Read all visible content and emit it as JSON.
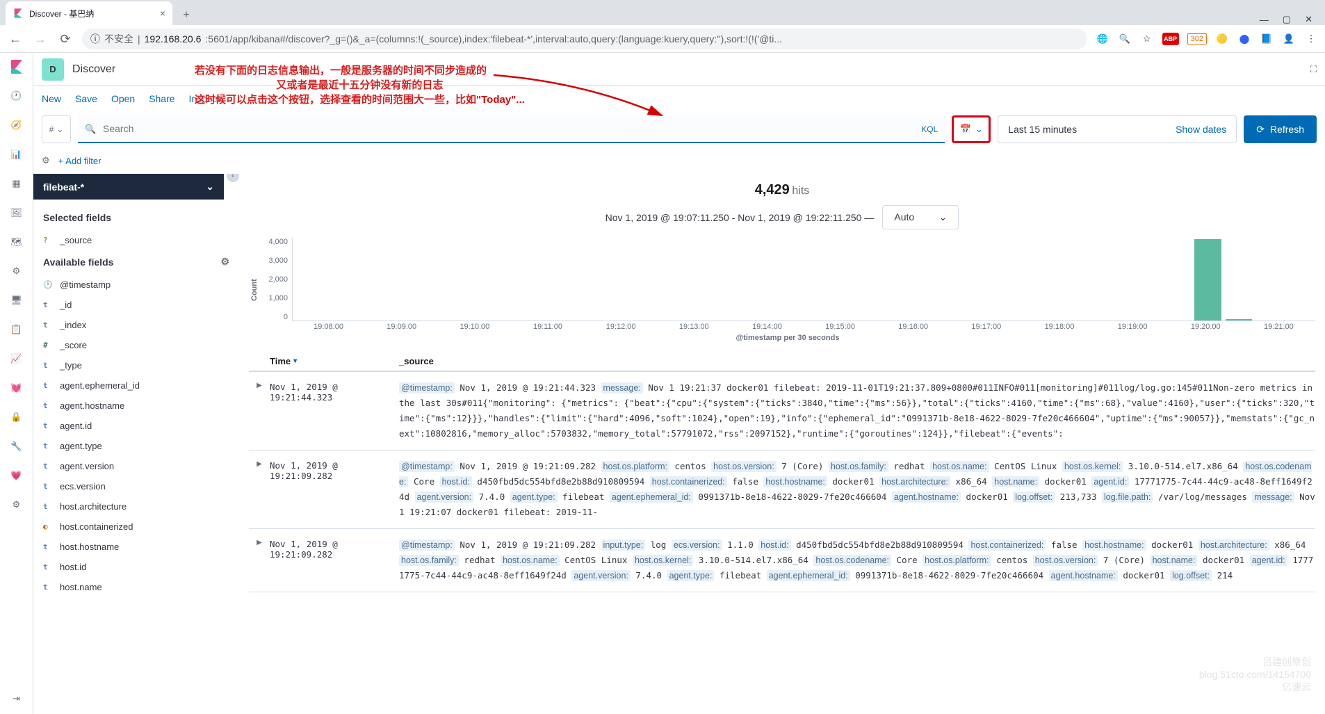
{
  "browser": {
    "tab_title": "Discover - 基巴纳",
    "url_insecure": "不安全",
    "url_domain": "192.168.20.6",
    "url_port_path": ":5601/app/kibana#/discover?_g=()&_a=(columns:!(_source),index:'filebeat-*',interval:auto,query:(language:kuery,query:''),sort:!(!('@ti...",
    "badge": "302"
  },
  "header": {
    "space": "D",
    "breadcrumb": "Discover"
  },
  "top_menu": [
    "New",
    "Save",
    "Open",
    "Share",
    "Inspect"
  ],
  "annotation": {
    "line1": "若没有下面的日志信息输出，一般是服务器的时间不同步造成的",
    "line2": "又或者是最近十五分钟没有新的日志",
    "line3": "这时候可以点击这个按钮，选择查看的时间范围大一些，比如\"Today\"..."
  },
  "query": {
    "filter_btn": "#",
    "search_placeholder": "Search",
    "kql": "KQL",
    "time_range": "Last 15 minutes",
    "show_dates": "Show dates",
    "refresh": "Refresh",
    "add_filter": "+ Add filter"
  },
  "sidebar": {
    "index_pattern": "filebeat-*",
    "selected_title": "Selected fields",
    "selected_fields": [
      {
        "type": "?",
        "name": "_source"
      }
    ],
    "available_title": "Available fields",
    "available_fields": [
      {
        "type": "clock",
        "name": "@timestamp"
      },
      {
        "type": "t",
        "name": "_id"
      },
      {
        "type": "t",
        "name": "_index"
      },
      {
        "type": "#",
        "name": "_score"
      },
      {
        "type": "t",
        "name": "_type"
      },
      {
        "type": "t",
        "name": "agent.ephemeral_id"
      },
      {
        "type": "t",
        "name": "agent.hostname"
      },
      {
        "type": "t",
        "name": "agent.id"
      },
      {
        "type": "t",
        "name": "agent.type"
      },
      {
        "type": "t",
        "name": "agent.version"
      },
      {
        "type": "t",
        "name": "ecs.version"
      },
      {
        "type": "t",
        "name": "host.architecture"
      },
      {
        "type": "bool",
        "name": "host.containerized"
      },
      {
        "type": "t",
        "name": "host.hostname"
      },
      {
        "type": "t",
        "name": "host.id"
      },
      {
        "type": "t",
        "name": "host.name"
      }
    ]
  },
  "content": {
    "hits": "4,429",
    "hits_label": "hits",
    "time_range": "Nov 1, 2019 @ 19:07:11.250 - Nov 1, 2019 @ 19:22:11.250 —",
    "interval": "Auto",
    "x_axis_label": "@timestamp per 30 seconds",
    "y_axis_label": "Count",
    "cols": {
      "time": "Time",
      "source": "_source"
    }
  },
  "chart_data": {
    "type": "bar",
    "y_ticks": [
      "4,000",
      "3,000",
      "2,000",
      "1,000",
      "0"
    ],
    "x_ticks": [
      "19:08:00",
      "19:09:00",
      "19:10:00",
      "19:11:00",
      "19:12:00",
      "19:13:00",
      "19:14:00",
      "19:15:00",
      "19:16:00",
      "19:17:00",
      "19:18:00",
      "19:19:00",
      "19:20:00",
      "19:21:00"
    ],
    "values": [
      {
        "pos_pct": 88.2,
        "width_pct": 2.6,
        "height_pct": 98
      },
      {
        "pos_pct": 91.2,
        "width_pct": 2.6,
        "height_pct": 2
      }
    ],
    "ylim": [
      0,
      4500
    ]
  },
  "docs": [
    {
      "time": "Nov 1, 2019 @ 19:21:44.323",
      "kv": [
        {
          "k": "@timestamp:",
          "v": "Nov 1, 2019 @ 19:21:44.323"
        },
        {
          "k": "message:",
          "v": "Nov 1 19:21:37 docker01 filebeat: 2019-11-01T19:21:37.809+0800#011INFO#011[monitoring]#011log/log.go:145#011Non-zero metrics in the last 30s#011{\"monitoring\": {\"metrics\": {\"beat\":{\"cpu\":{\"system\":{\"ticks\":3840,\"time\":{\"ms\":56}},\"total\":{\"ticks\":4160,\"time\":{\"ms\":68},\"value\":4160},\"user\":{\"ticks\":320,\"time\":{\"ms\":12}}},\"handles\":{\"limit\":{\"hard\":4096,\"soft\":1024},\"open\":19},\"info\":{\"ephemeral_id\":\"0991371b-8e18-4622-8029-7fe20c466604\",\"uptime\":{\"ms\":90057}},\"memstats\":{\"gc_next\":10802816,\"memory_alloc\":5703832,\"memory_total\":57791072,\"rss\":2097152},\"runtime\":{\"goroutines\":124}},\"filebeat\":{\"events\":"
        }
      ]
    },
    {
      "time": "Nov 1, 2019 @ 19:21:09.282",
      "kv": [
        {
          "k": "@timestamp:",
          "v": "Nov 1, 2019 @ 19:21:09.282"
        },
        {
          "k": "host.os.platform:",
          "v": "centos"
        },
        {
          "k": "host.os.version:",
          "v": "7 (Core)"
        },
        {
          "k": "host.os.family:",
          "v": "redhat"
        },
        {
          "k": "host.os.name:",
          "v": "CentOS Linux"
        },
        {
          "k": "host.os.kernel:",
          "v": "3.10.0-514.el7.x86_64"
        },
        {
          "k": "host.os.codename:",
          "v": "Core"
        },
        {
          "k": "host.id:",
          "v": "d450fbd5dc554bfd8e2b88d910809594"
        },
        {
          "k": "host.containerized:",
          "v": "false"
        },
        {
          "k": "host.hostname:",
          "v": "docker01"
        },
        {
          "k": "host.architecture:",
          "v": "x86_64"
        },
        {
          "k": "host.name:",
          "v": "docker01"
        },
        {
          "k": "agent.id:",
          "v": "17771775-7c44-44c9-ac48-8eff1649f24d"
        },
        {
          "k": "agent.version:",
          "v": "7.4.0"
        },
        {
          "k": "agent.type:",
          "v": "filebeat"
        },
        {
          "k": "agent.ephemeral_id:",
          "v": "0991371b-8e18-4622-8029-7fe20c466604"
        },
        {
          "k": "agent.hostname:",
          "v": "docker01"
        },
        {
          "k": "log.offset:",
          "v": "213,733"
        },
        {
          "k": "log.file.path:",
          "v": "/var/log/messages"
        },
        {
          "k": "message:",
          "v": "Nov 1 19:21:07 docker01 filebeat: 2019-11-"
        }
      ]
    },
    {
      "time": "Nov 1, 2019 @ 19:21:09.282",
      "kv": [
        {
          "k": "@timestamp:",
          "v": "Nov 1, 2019 @ 19:21:09.282"
        },
        {
          "k": "input.type:",
          "v": "log"
        },
        {
          "k": "ecs.version:",
          "v": "1.1.0"
        },
        {
          "k": "host.id:",
          "v": "d450fbd5dc554bfd8e2b88d910809594"
        },
        {
          "k": "host.containerized:",
          "v": "false"
        },
        {
          "k": "host.hostname:",
          "v": "docker01"
        },
        {
          "k": "host.architecture:",
          "v": "x86_64"
        },
        {
          "k": "host.os.family:",
          "v": "redhat"
        },
        {
          "k": "host.os.name:",
          "v": "CentOS Linux"
        },
        {
          "k": "host.os.kernel:",
          "v": "3.10.0-514.el7.x86_64"
        },
        {
          "k": "host.os.codename:",
          "v": "Core"
        },
        {
          "k": "host.os.platform:",
          "v": "centos"
        },
        {
          "k": "host.os.version:",
          "v": "7 (Core)"
        },
        {
          "k": "host.name:",
          "v": "docker01"
        },
        {
          "k": "agent.id:",
          "v": "17771775-7c44-44c9-ac48-8eff1649f24d"
        },
        {
          "k": "agent.version:",
          "v": "7.4.0"
        },
        {
          "k": "agent.type:",
          "v": "filebeat"
        },
        {
          "k": "agent.ephemeral_id:",
          "v": "0991371b-8e18-4622-8029-7fe20c466604"
        },
        {
          "k": "agent.hostname:",
          "v": "docker01"
        },
        {
          "k": "log.offset:",
          "v": "214"
        }
      ]
    }
  ],
  "watermark": {
    "line1": "吕建创原创",
    "line2": "blog.51cto.com/14154700",
    "line3": "亿速云"
  }
}
